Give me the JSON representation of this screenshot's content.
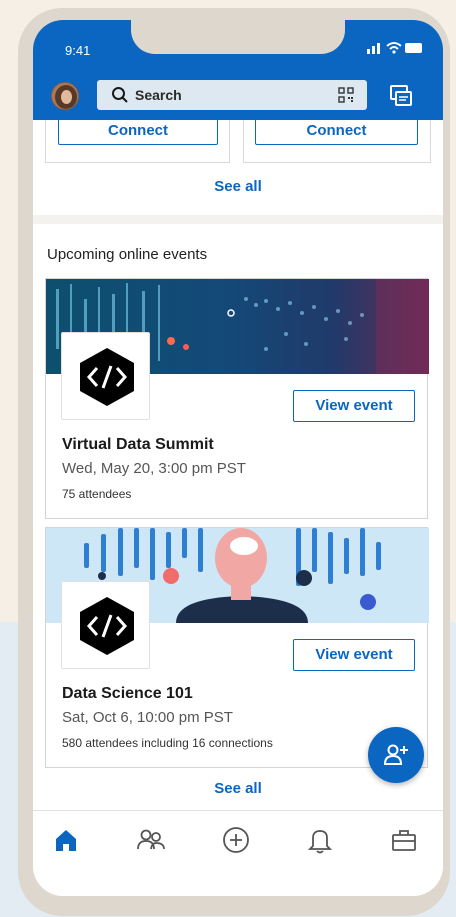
{
  "status_bar": {
    "time": "9:41"
  },
  "top_bar": {
    "search_placeholder": "Search",
    "icons": [
      "avatar",
      "search-icon",
      "qr-code-icon",
      "messaging-icon"
    ]
  },
  "people_you_may_know": {
    "connect_labels": [
      "Connect",
      "Connect"
    ],
    "see_all": "See all"
  },
  "events": {
    "section_title": "Upcoming online events",
    "items": [
      {
        "title": "Virtual Data Summit",
        "date": "Wed, May 20, 3:00 pm PST",
        "attendees": "75 attendees",
        "button": "View event"
      },
      {
        "title": "Data Science 101",
        "date": "Sat, Oct 6, 10:00 pm PST",
        "attendees": "580 attendees including 16 connections",
        "button": "View event"
      }
    ],
    "see_all": "See all"
  },
  "bottom_nav": {
    "items": [
      "home-icon",
      "my-network-icon",
      "post-icon",
      "notifications-icon",
      "jobs-icon"
    ]
  },
  "colors": {
    "brand_blue": "#0b66c2",
    "page_background": "#f6efe6"
  }
}
